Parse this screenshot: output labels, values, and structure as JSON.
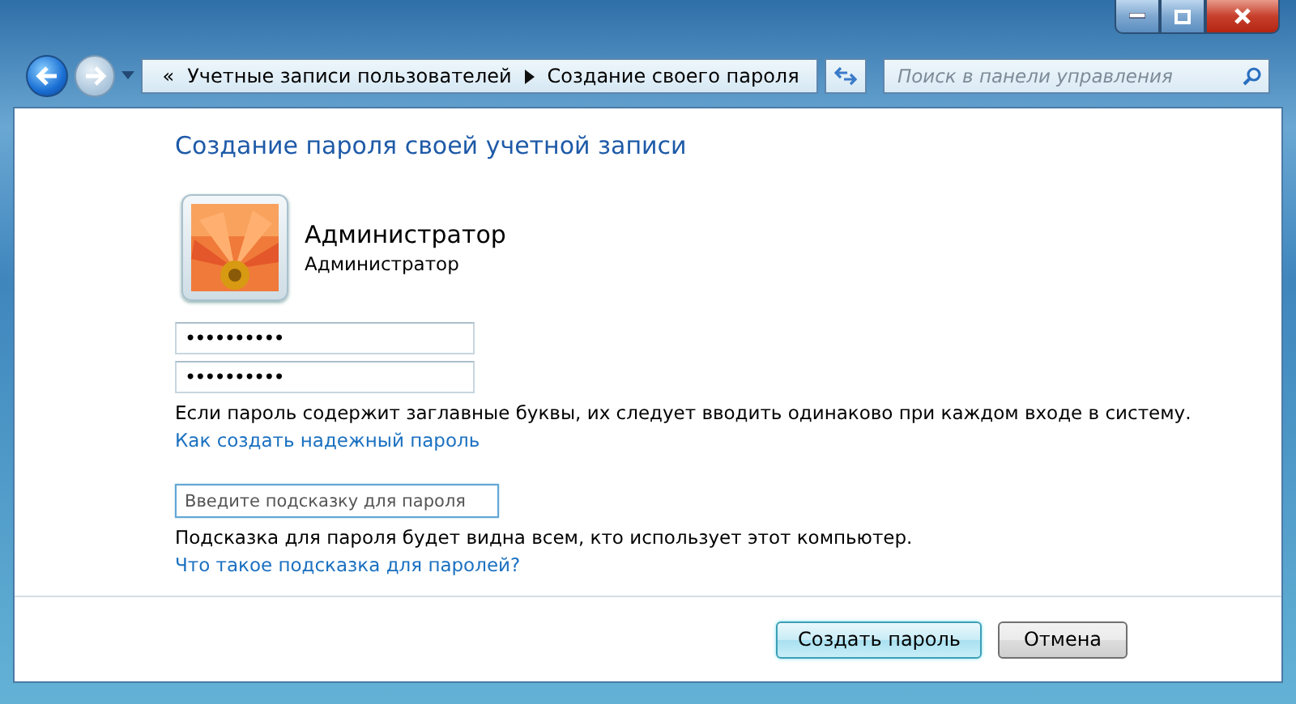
{
  "window": {
    "caption_buttons": [
      {
        "kind": "minimize"
      },
      {
        "kind": "maximize"
      },
      {
        "kind": "close"
      }
    ]
  },
  "address_bar": {
    "overflow": "«",
    "crumbs": [
      "Учетные записи пользователей",
      "Создание своего пароля"
    ]
  },
  "search": {
    "placeholder": "Поиск в панели управления"
  },
  "heading": "Создание пароля своей учетной записи",
  "account": {
    "name": "Администратор",
    "type": "Администратор"
  },
  "password_fields": [
    {
      "value": "••••••••••"
    },
    {
      "value": "••••••••••"
    }
  ],
  "caps_note": "Если пароль содержит заглавные буквы, их следует вводить одинаково при каждом входе в систему.",
  "strong_link": "Как создать надежный пароль",
  "hint_field": {
    "placeholder": "Введите подсказку для пароля",
    "focused": true
  },
  "hint_note": "Подсказка для пароля будет видна всем, кто использует этот компьютер.",
  "hint_link": "Что такое подсказка для паролей?",
  "buttons": [
    {
      "label": "Создать пароль",
      "default": true
    },
    {
      "label": "Отмена",
      "default": false
    }
  ]
}
